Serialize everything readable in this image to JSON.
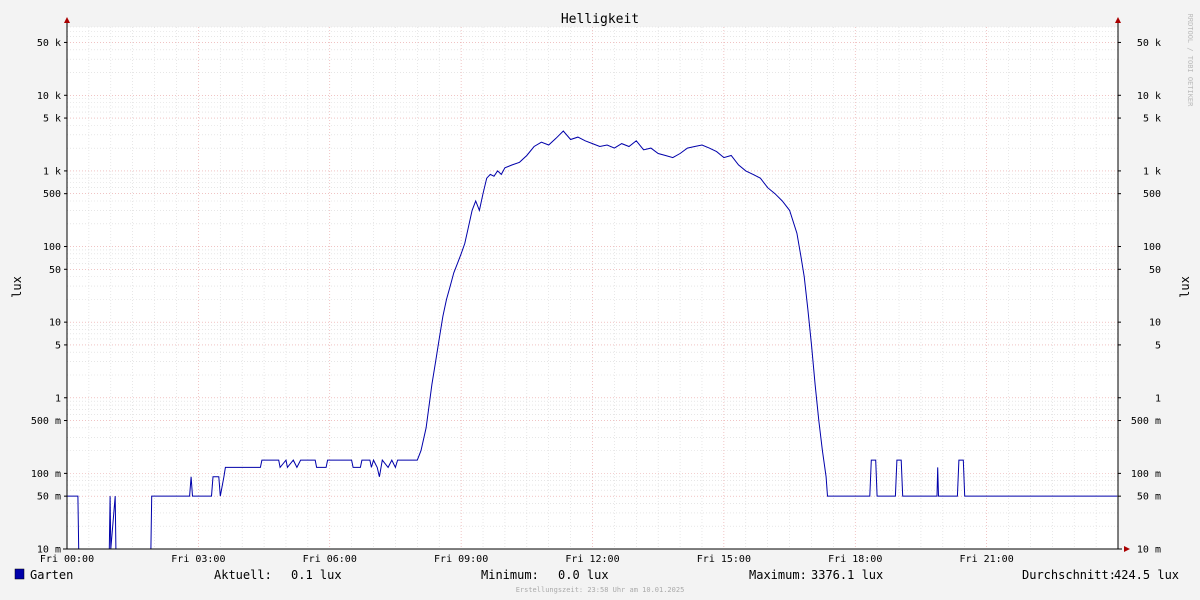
{
  "colors": {
    "background": "#f3f3f3",
    "canvas": "#ffffff",
    "grid_major": "#e8a0a0",
    "grid_minor": "#d8d8d8",
    "series": "#0000aa",
    "axis": "#000000",
    "arrow": "#aa0000"
  },
  "chart_data": {
    "type": "line",
    "title": "Helligkeit",
    "ylabel": "lux",
    "y_scale": "log",
    "ylim": [
      0.01,
      80000
    ],
    "xlim": [
      "Fri 00:00",
      "Sat 00:00"
    ],
    "x_ticks": [
      "Fri 00:00",
      "Fri 03:00",
      "Fri 06:00",
      "Fri 09:00",
      "Fri 12:00",
      "Fri 15:00",
      "Fri 18:00",
      "Fri 21:00"
    ],
    "y_ticks": [
      {
        "value": 50000,
        "label": "50 k"
      },
      {
        "value": 10000,
        "label": "10 k"
      },
      {
        "value": 5000,
        "label": "5 k"
      },
      {
        "value": 1000,
        "label": "1 k"
      },
      {
        "value": 500,
        "label": "500"
      },
      {
        "value": 100,
        "label": "100"
      },
      {
        "value": 50,
        "label": "50"
      },
      {
        "value": 10,
        "label": "10"
      },
      {
        "value": 5,
        "label": "5"
      },
      {
        "value": 1,
        "label": "1"
      },
      {
        "value": 0.5,
        "label": "500 m"
      },
      {
        "value": 0.1,
        "label": "100 m"
      },
      {
        "value": 0.05,
        "label": "50 m"
      },
      {
        "value": 0.01,
        "label": "10 m"
      }
    ],
    "series": [
      {
        "name": "Garten",
        "points": [
          [
            "00:00",
            0.05
          ],
          [
            "00:15",
            0.05
          ],
          [
            "00:16",
            0.01
          ],
          [
            "00:58",
            0.01
          ],
          [
            "00:59",
            0.05
          ],
          [
            "01:00",
            0.01
          ],
          [
            "01:06",
            0.05
          ],
          [
            "01:07",
            0.01
          ],
          [
            "01:55",
            0.01
          ],
          [
            "01:56",
            0.05
          ],
          [
            "02:48",
            0.05
          ],
          [
            "02:50",
            0.09
          ],
          [
            "02:52",
            0.05
          ],
          [
            "03:18",
            0.05
          ],
          [
            "03:20",
            0.09
          ],
          [
            "03:28",
            0.09
          ],
          [
            "03:30",
            0.05
          ],
          [
            "03:35",
            0.09
          ],
          [
            "03:37",
            0.12
          ],
          [
            "04:00",
            0.12
          ],
          [
            "04:25",
            0.12
          ],
          [
            "04:27",
            0.15
          ],
          [
            "04:50",
            0.15
          ],
          [
            "04:52",
            0.12
          ],
          [
            "05:00",
            0.15
          ],
          [
            "05:02",
            0.12
          ],
          [
            "05:10",
            0.15
          ],
          [
            "05:15",
            0.12
          ],
          [
            "05:20",
            0.15
          ],
          [
            "05:40",
            0.15
          ],
          [
            "05:42",
            0.12
          ],
          [
            "05:55",
            0.12
          ],
          [
            "05:57",
            0.15
          ],
          [
            "06:30",
            0.15
          ],
          [
            "06:32",
            0.12
          ],
          [
            "06:42",
            0.12
          ],
          [
            "06:44",
            0.15
          ],
          [
            "06:55",
            0.15
          ],
          [
            "06:57",
            0.12
          ],
          [
            "07:00",
            0.15
          ],
          [
            "07:05",
            0.12
          ],
          [
            "07:08",
            0.09
          ],
          [
            "07:12",
            0.15
          ],
          [
            "07:20",
            0.12
          ],
          [
            "07:25",
            0.15
          ],
          [
            "07:30",
            0.12
          ],
          [
            "07:33",
            0.15
          ],
          [
            "08:00",
            0.15
          ],
          [
            "08:05",
            0.2
          ],
          [
            "08:12",
            0.4
          ],
          [
            "08:20",
            1.5
          ],
          [
            "08:25",
            3
          ],
          [
            "08:30",
            6
          ],
          [
            "08:35",
            12
          ],
          [
            "08:40",
            20
          ],
          [
            "08:45",
            30
          ],
          [
            "08:50",
            45
          ],
          [
            "08:55",
            60
          ],
          [
            "09:00",
            80
          ],
          [
            "09:05",
            110
          ],
          [
            "09:10",
            180
          ],
          [
            "09:15",
            300
          ],
          [
            "09:20",
            400
          ],
          [
            "09:25",
            300
          ],
          [
            "09:30",
            500
          ],
          [
            "09:35",
            800
          ],
          [
            "09:40",
            900
          ],
          [
            "09:45",
            850
          ],
          [
            "09:50",
            1000
          ],
          [
            "09:55",
            900
          ],
          [
            "10:00",
            1100
          ],
          [
            "10:10",
            1200
          ],
          [
            "10:20",
            1300
          ],
          [
            "10:30",
            1600
          ],
          [
            "10:40",
            2100
          ],
          [
            "10:50",
            2400
          ],
          [
            "11:00",
            2200
          ],
          [
            "11:10",
            2700
          ],
          [
            "11:20",
            3376
          ],
          [
            "11:30",
            2600
          ],
          [
            "11:40",
            2800
          ],
          [
            "11:50",
            2500
          ],
          [
            "12:00",
            2300
          ],
          [
            "12:10",
            2100
          ],
          [
            "12:20",
            2200
          ],
          [
            "12:30",
            2000
          ],
          [
            "12:40",
            2300
          ],
          [
            "12:50",
            2100
          ],
          [
            "13:00",
            2500
          ],
          [
            "13:10",
            1900
          ],
          [
            "13:20",
            2000
          ],
          [
            "13:30",
            1700
          ],
          [
            "13:40",
            1600
          ],
          [
            "13:50",
            1500
          ],
          [
            "14:00",
            1700
          ],
          [
            "14:10",
            2000
          ],
          [
            "14:20",
            2100
          ],
          [
            "14:30",
            2200
          ],
          [
            "14:40",
            2000
          ],
          [
            "14:50",
            1800
          ],
          [
            "15:00",
            1500
          ],
          [
            "15:10",
            1600
          ],
          [
            "15:20",
            1200
          ],
          [
            "15:30",
            1000
          ],
          [
            "15:40",
            900
          ],
          [
            "15:50",
            800
          ],
          [
            "16:00",
            600
          ],
          [
            "16:10",
            500
          ],
          [
            "16:20",
            400
          ],
          [
            "16:30",
            300
          ],
          [
            "16:40",
            150
          ],
          [
            "16:45",
            80
          ],
          [
            "16:50",
            40
          ],
          [
            "16:55",
            15
          ],
          [
            "17:00",
            5
          ],
          [
            "17:05",
            1.5
          ],
          [
            "17:10",
            0.5
          ],
          [
            "17:15",
            0.2
          ],
          [
            "17:20",
            0.09
          ],
          [
            "17:22",
            0.05
          ],
          [
            "18:20",
            0.05
          ],
          [
            "18:22",
            0.15
          ],
          [
            "18:28",
            0.15
          ],
          [
            "18:30",
            0.05
          ],
          [
            "18:55",
            0.05
          ],
          [
            "18:57",
            0.15
          ],
          [
            "19:03",
            0.15
          ],
          [
            "19:05",
            0.05
          ],
          [
            "19:52",
            0.05
          ],
          [
            "19:53",
            0.12
          ],
          [
            "19:54",
            0.05
          ],
          [
            "20:20",
            0.05
          ],
          [
            "20:22",
            0.15
          ],
          [
            "20:28",
            0.15
          ],
          [
            "20:30",
            0.05
          ],
          [
            "23:59",
            0.05
          ]
        ]
      }
    ]
  },
  "legend": {
    "series_name": "Garten",
    "aktuell_label": "Aktuell:",
    "aktuell_value": "0.1 lux",
    "minimum_label": "Minimum:",
    "minimum_value": "0.0 lux",
    "maximum_label": "Maximum:",
    "maximum_value": "3376.1 lux",
    "durchschnitt_label": "Durchschnitt:",
    "durchschnitt_value": "424.5 lux"
  },
  "footer": "Erstellungszeit: 23:58 Uhr am 10.01.2025",
  "watermark": "RRDTOOL / TOBI OETIKER"
}
